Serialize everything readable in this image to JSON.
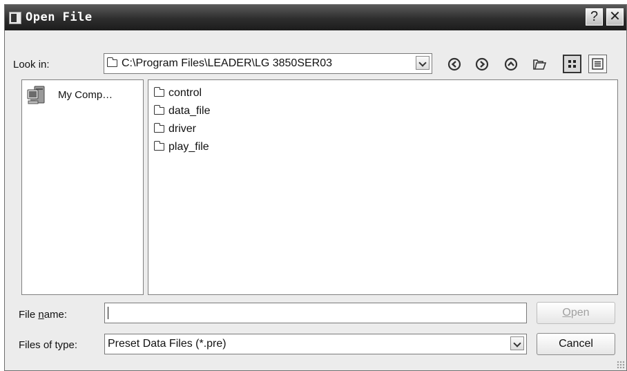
{
  "window": {
    "title": "Open File",
    "help_glyph": "?",
    "close_glyph": "✕"
  },
  "look_in": {
    "label": "Look in:",
    "path": "C:\\Program Files\\LEADER\\LG 3850SER03"
  },
  "toolbar": {
    "icons": [
      "back-icon",
      "forward-icon",
      "up-folder-icon",
      "new-folder-icon",
      "list-view-icon",
      "detail-view-icon"
    ]
  },
  "sidebar": {
    "items": [
      {
        "label": "My Comp…",
        "icon": "computer-icon"
      }
    ]
  },
  "files": [
    {
      "name": "control",
      "icon": "folder-icon"
    },
    {
      "name": "data_file",
      "icon": "folder-icon"
    },
    {
      "name": "driver",
      "icon": "folder-icon"
    },
    {
      "name": "play_file",
      "icon": "folder-icon"
    }
  ],
  "file_name": {
    "label_pre": "File ",
    "label_ul": "n",
    "label_post": "ame:",
    "value": ""
  },
  "file_type": {
    "label": "Files of type:",
    "value": "Preset Data Files (*.pre)"
  },
  "buttons": {
    "open_ul": "O",
    "open_rest": "pen",
    "cancel": "Cancel"
  }
}
